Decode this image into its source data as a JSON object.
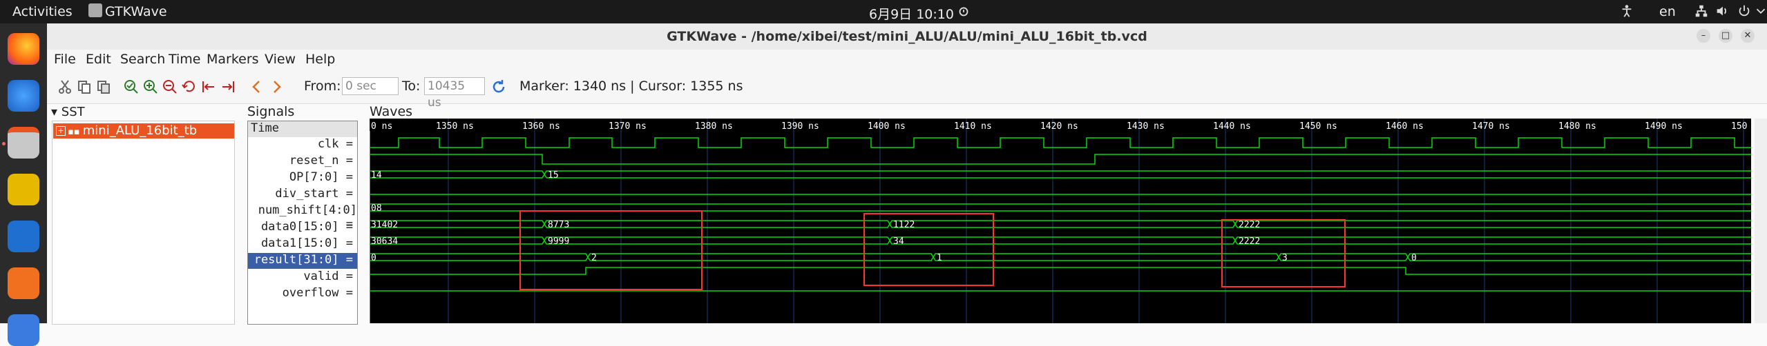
{
  "topbar": {
    "activities": "Activities",
    "app": "GTKWave",
    "datetime": "6月9日  10:10",
    "lang": "en"
  },
  "window": {
    "title": "GTKWave - /home/xibei/test/mini_ALU/ALU/mini_ALU_16bit_tb.vcd"
  },
  "menu": [
    "File",
    "Edit",
    "Search",
    "Time",
    "Markers",
    "View",
    "Help"
  ],
  "toolbar": {
    "from_label": "From:",
    "from_value": "0 sec",
    "to_label": "To:",
    "to_value": "10435 us",
    "marker_text": "Marker: 1340 ns  |  Cursor: 1355 ns"
  },
  "sst": {
    "title": "SST",
    "item": "mini_ALU_16bit_tb"
  },
  "signals": {
    "title": "Signals",
    "rows": [
      "Time",
      "clk =",
      "reset_n =",
      "OP[7:0] =",
      "div_start =",
      "num_shift[4:0] =",
      "data0[15:0] =",
      "data1[15:0] =",
      "result[31:0] =",
      "valid =",
      "overflow ="
    ]
  },
  "waves": {
    "title": "Waves",
    "ticks": [
      "0 ns",
      "1350 ns",
      "1360 ns",
      "1370 ns",
      "1380 ns",
      "1390 ns",
      "1400 ns",
      "1410 ns",
      "1420 ns",
      "1430 ns",
      "1440 ns",
      "1450 ns",
      "1460 ns",
      "1470 ns",
      "1480 ns",
      "1490 ns",
      "150"
    ],
    "op": [
      "14",
      "15"
    ],
    "num_shift": "08",
    "data0": [
      "31402",
      "8773",
      "1122",
      "2222"
    ],
    "data1": [
      "30634",
      "9999",
      "34",
      "2222"
    ],
    "result": [
      "0",
      "2",
      "1",
      "3",
      "0"
    ]
  },
  "colors": {
    "wave_green": "#00dd00",
    "highlight_box": "#ff3333",
    "selected_signal_bg": "#3a5fa8",
    "sst_selected_bg": "#e95420"
  }
}
